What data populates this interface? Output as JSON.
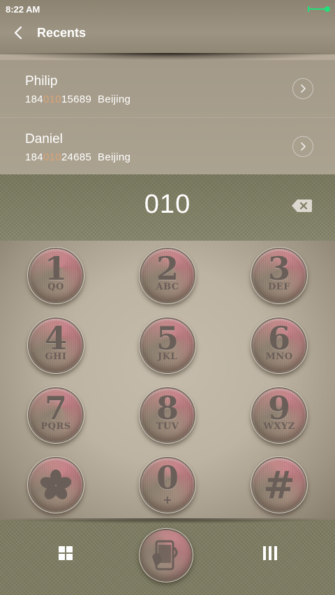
{
  "status_bar": {
    "time": "8:22 AM"
  },
  "header": {
    "title": "Recents"
  },
  "recents": [
    {
      "name": "Philip",
      "number_prefix": "184",
      "number_match": "010",
      "number_suffix": "15689",
      "location": "Beijing"
    },
    {
      "name": "Daniel",
      "number_prefix": "184",
      "number_match": "010",
      "number_suffix": "24685",
      "location": "Beijing"
    }
  ],
  "dialer": {
    "input": "010",
    "keys": [
      {
        "digit": "1",
        "letters": "QO"
      },
      {
        "digit": "2",
        "letters": "ABC"
      },
      {
        "digit": "3",
        "letters": "DEF"
      },
      {
        "digit": "4",
        "letters": "GHI"
      },
      {
        "digit": "5",
        "letters": "JKL"
      },
      {
        "digit": "6",
        "letters": "MNO"
      },
      {
        "digit": "7",
        "letters": "PQRS"
      },
      {
        "digit": "8",
        "letters": "TUV"
      },
      {
        "digit": "9",
        "letters": "WXYZ"
      },
      {
        "digit": "*",
        "letters": ""
      },
      {
        "digit": "0",
        "letters": "+"
      },
      {
        "digit": "#",
        "letters": ""
      }
    ]
  },
  "colors": {
    "match_highlight": "#d9a377",
    "key_ink": "#6a5e58",
    "battery": "#22e07a"
  },
  "icons": {
    "back": "chevron-left-icon",
    "info": "chevron-right-icon",
    "backspace": "backspace-icon",
    "nav_left": "grid-icon",
    "nav_right": "menu-bars-icon",
    "call": "phone-call-icon"
  }
}
